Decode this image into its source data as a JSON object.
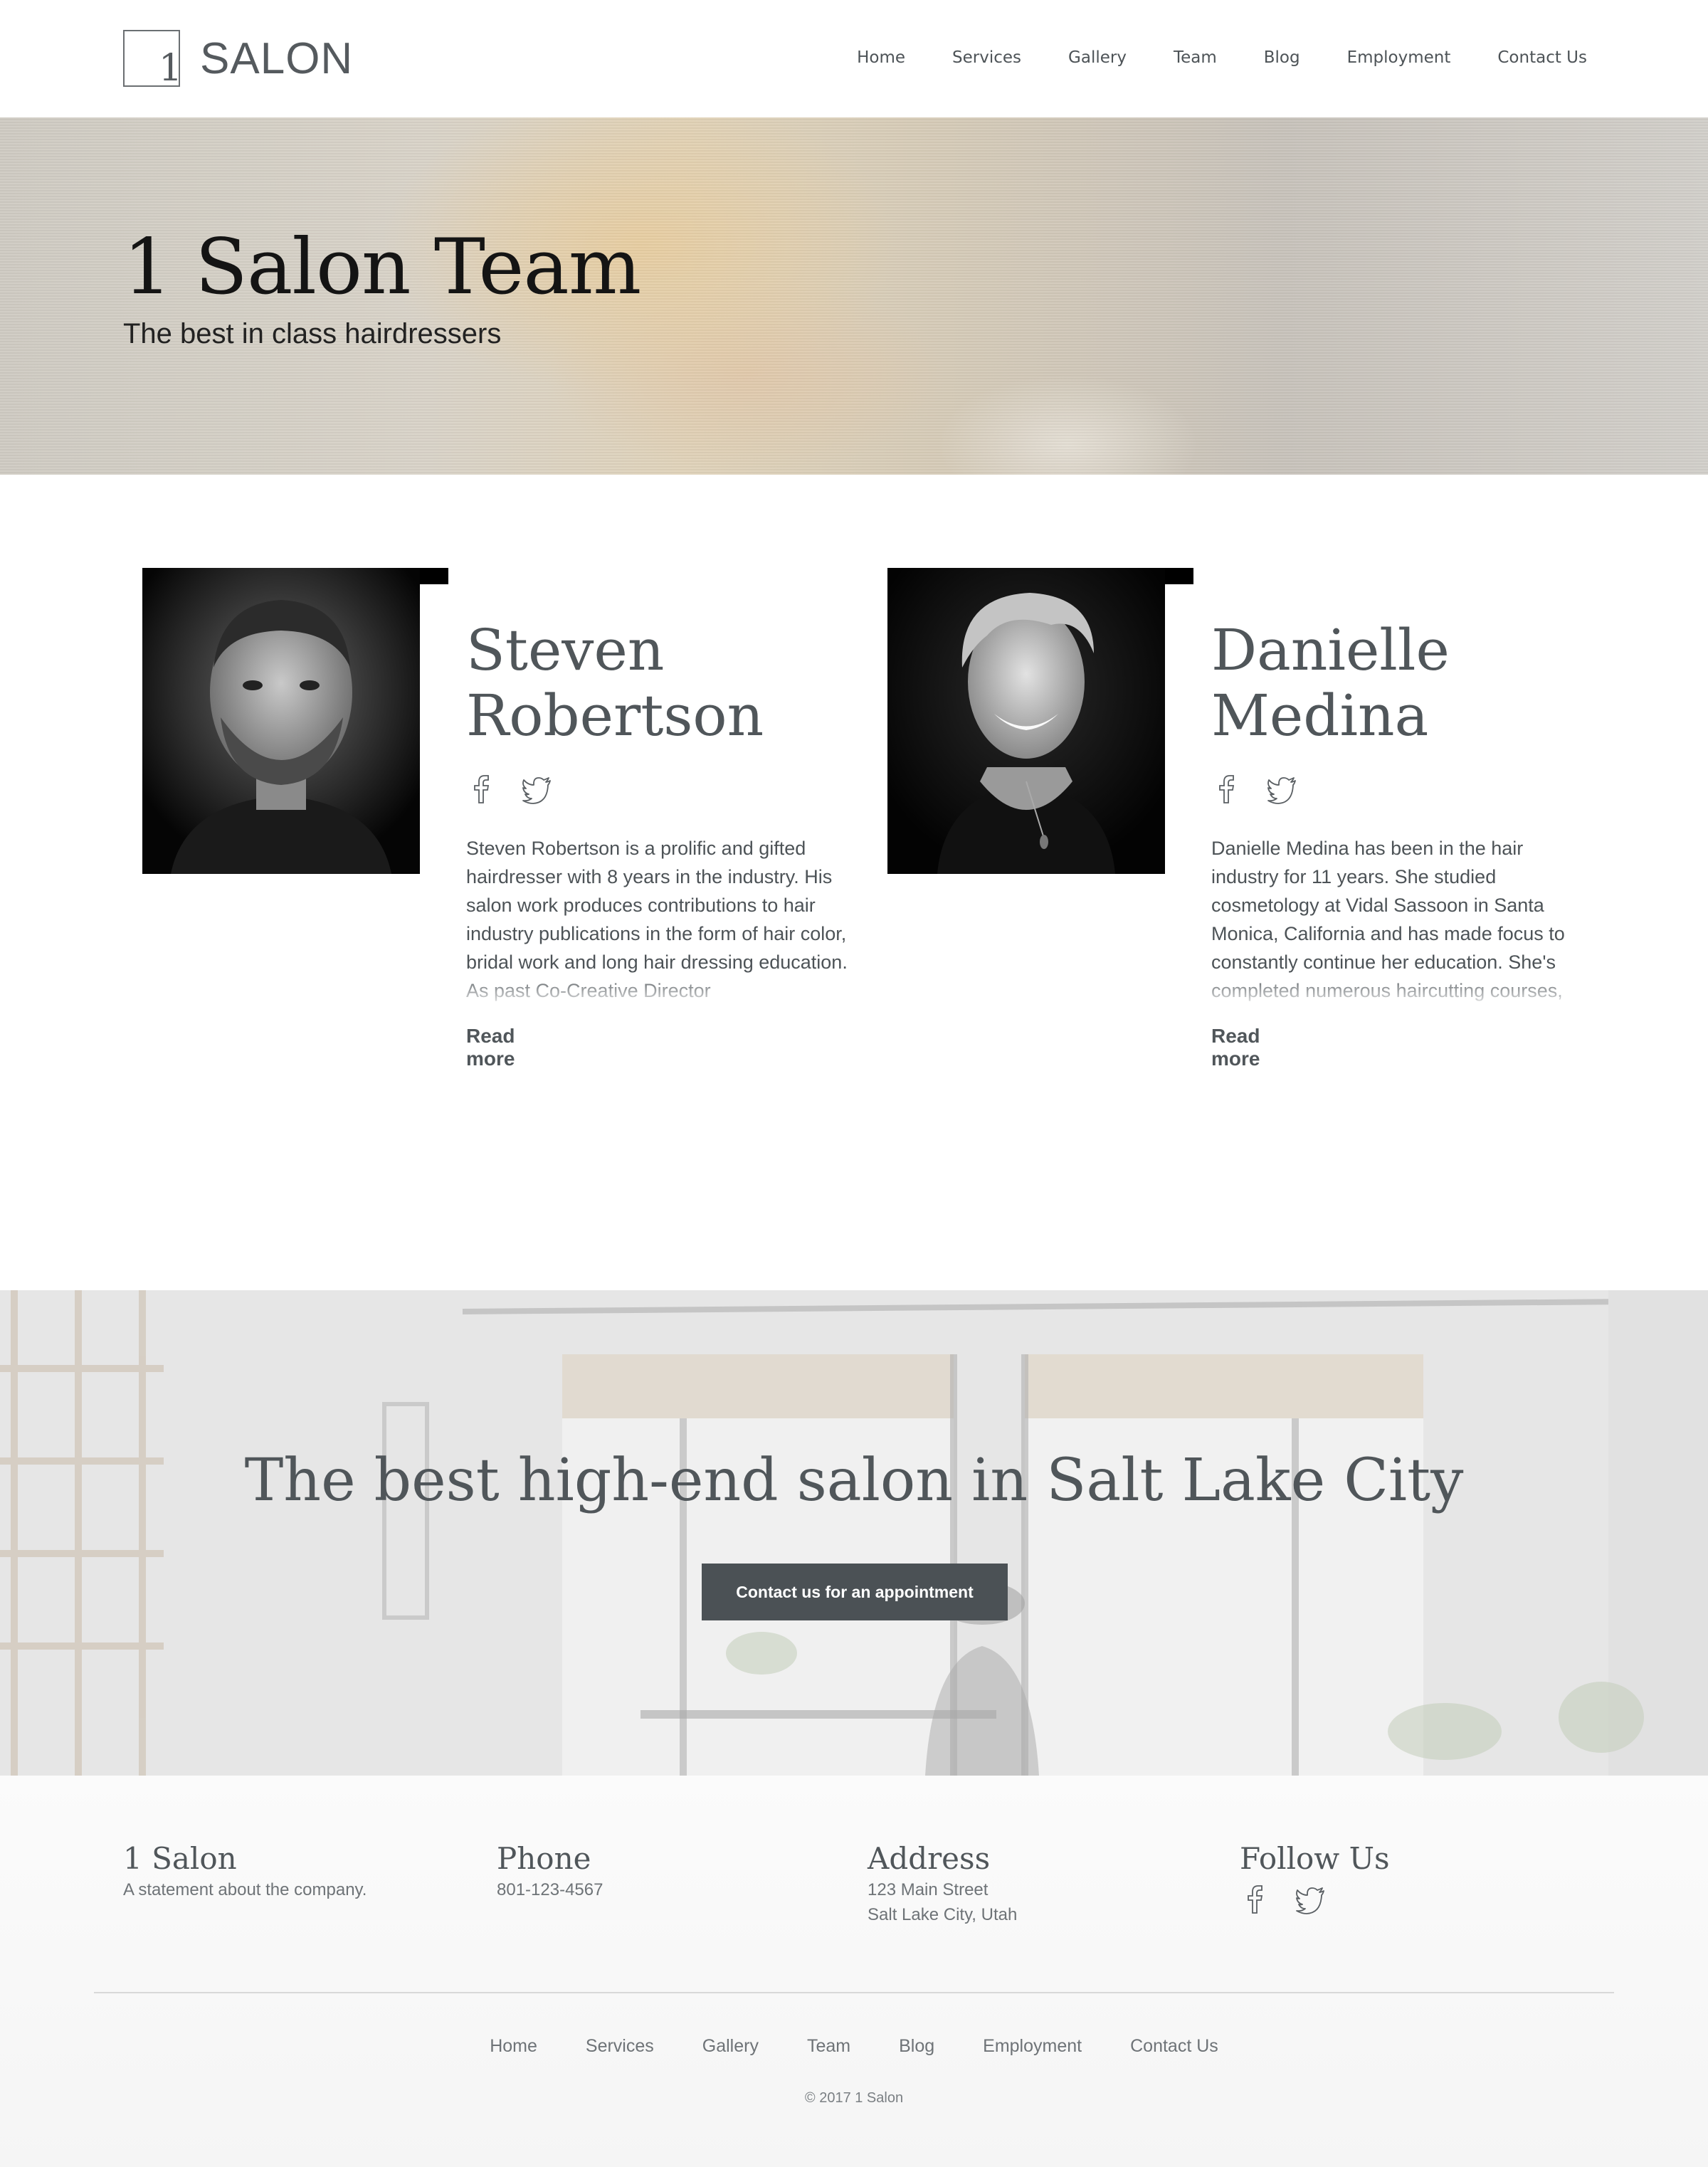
{
  "header": {
    "logo_mark": "1",
    "logo_text": "SALON",
    "nav": [
      "Home",
      "Services",
      "Gallery",
      "Team",
      "Blog",
      "Employment",
      "Contact Us"
    ]
  },
  "hero": {
    "title": "1 Salon Team",
    "subtitle": "The best in class hairdressers"
  },
  "team": [
    {
      "name_line1": "Steven",
      "name_line2": "Robertson",
      "bio": "Steven Robertson is a prolific and gifted hairdresser with 8 years in the industry. His salon work produces contributions to hair industry publications in the form of hair color, bridal work and long hair dressing education. As past Co-Creative Director",
      "read_more": "Read more",
      "social_icons": [
        "facebook-icon",
        "twitter-icon"
      ]
    },
    {
      "name_line1": "Danielle",
      "name_line2": "Medina",
      "bio": "Danielle Medina has been in the hair industry for 11 years. She studied cosmetology at Vidal Sassoon in Santa Monica, California and has made focus to constantly continue her education. She's completed numerous haircutting courses,",
      "read_more": "Read more",
      "social_icons": [
        "facebook-icon",
        "twitter-icon"
      ]
    }
  ],
  "cta": {
    "title": "The best high-end salon in Salt Lake City",
    "button": "Contact us for an appointment"
  },
  "footer": {
    "company_title": "1 Salon",
    "company_text": "A statement about the company.",
    "phone_title": "Phone",
    "phone": "801-123-4567",
    "address_title": "Address",
    "address_line1": "123 Main Street",
    "address_line2": "Salt Lake City, Utah",
    "follow_title": "Follow Us",
    "nav": [
      "Home",
      "Services",
      "Gallery",
      "Team",
      "Blog",
      "Employment",
      "Contact Us"
    ],
    "copyright": "© 2017 1 Salon"
  },
  "colors": {
    "text": "#4d5357",
    "button_bg": "#4b5155",
    "photo_bg": "#000000"
  }
}
